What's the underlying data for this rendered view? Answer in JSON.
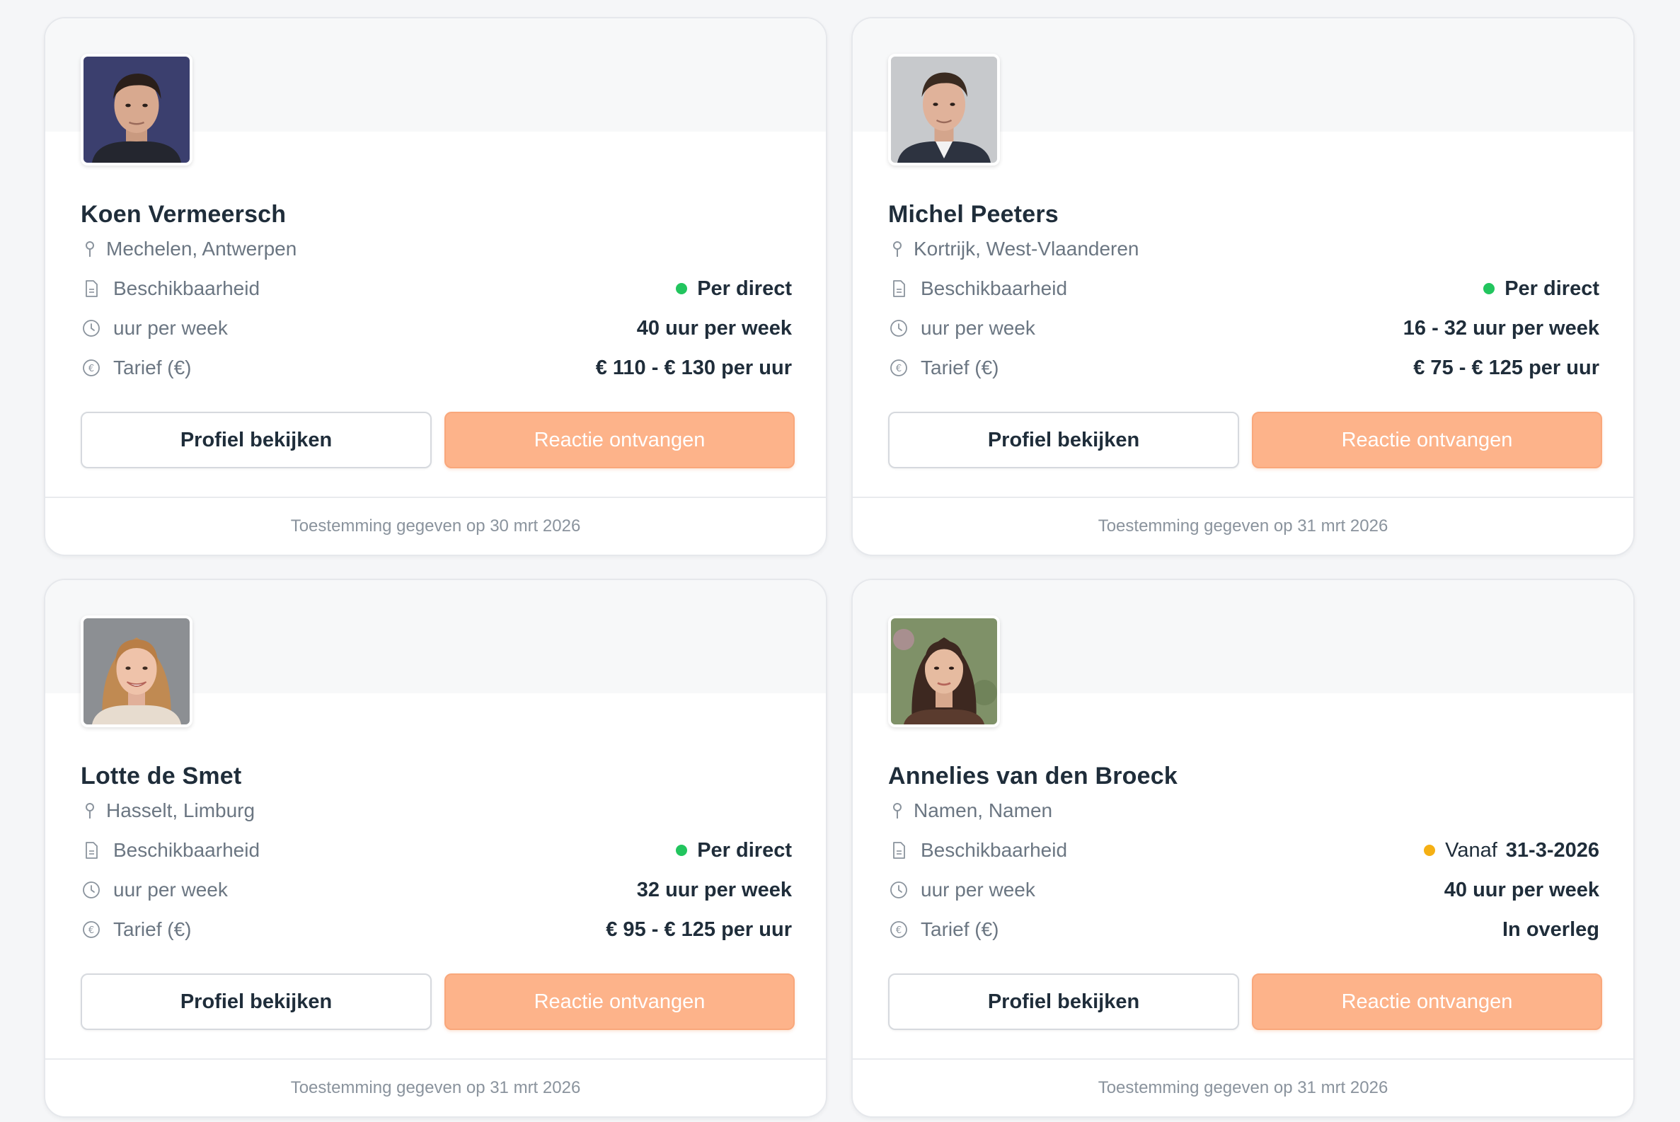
{
  "labels": {
    "availability": "Beschikbaarheid",
    "hours": "uur per week",
    "rate": "Tarief (€)",
    "view_profile": "Profiel bekijken",
    "response_received": "Reactie ontvangen"
  },
  "colors": {
    "available_now": "#22c55e",
    "available_from": "#f5b014",
    "accent": "#fdb38a"
  },
  "candidates": [
    {
      "name": "Koen Vermeersch",
      "location": "Mechelen, Antwerpen",
      "availability_prefix": "",
      "availability": "Per direct",
      "status": "available_now",
      "hours": "40 uur per week",
      "rate": "€ 110 - € 130 per uur",
      "consent": "Toestemming gegeven op 30 mrt 2026",
      "avatar": "man-dark-hair-photo"
    },
    {
      "name": "Michel Peeters",
      "location": "Kortrijk, West-Vlaanderen",
      "availability_prefix": "",
      "availability": "Per direct",
      "status": "available_now",
      "hours": "16 - 32 uur per week",
      "rate": "€ 75 - € 125 per uur",
      "consent": "Toestemming gegeven op 31 mrt 2026",
      "avatar": "man-suit-photo"
    },
    {
      "name": "Lotte de Smet",
      "location": "Hasselt, Limburg",
      "availability_prefix": "",
      "availability": "Per direct",
      "status": "available_now",
      "hours": "32 uur per week",
      "rate": "€ 95 - € 125 per uur",
      "consent": "Toestemming gegeven op 31 mrt 2026",
      "avatar": "woman-blonde-photo"
    },
    {
      "name": "Annelies van den Broeck",
      "location": "Namen, Namen",
      "availability_prefix": "Vanaf",
      "availability": "31-3-2026",
      "status": "available_from",
      "hours": "40 uur per week",
      "rate": "In overleg",
      "consent": "Toestemming gegeven op 31 mrt 2026",
      "avatar": "woman-dark-hair-photo"
    }
  ]
}
